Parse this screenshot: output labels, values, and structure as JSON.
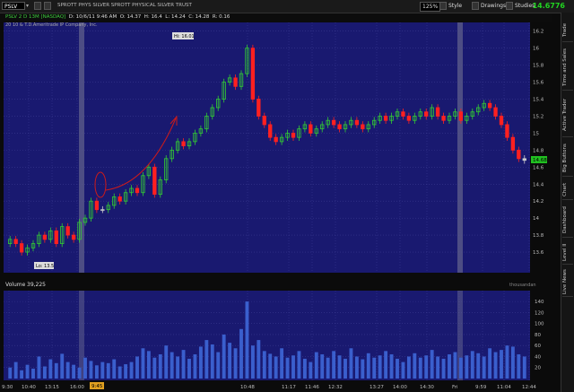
{
  "toolbar": {
    "symbol": "PSLV",
    "description": "SPROTT PHYS SILVER SPROTT PHYSICAL SILVER TRUST",
    "zoom_label": "125%",
    "style_label": "Style",
    "drawings_label": "Drawings",
    "studies_label": "Studies",
    "last_price": "14.6776"
  },
  "info": {
    "symbol_period": "PSLV 2 D 13M [NASDAQ]",
    "date_label": "D: 10/6/11 9:46 AM",
    "open_label": "O: 14.37",
    "high_label": "H: 16.4",
    "low_label": "L: 14.24",
    "close_label": "C: 14.28",
    "range_label": "R: 0.16",
    "copyright": "20 10 & T.D.Ameritrade IP Company, Inc."
  },
  "sidebar": {
    "tabs": [
      "Trade",
      "Time and Sales",
      "Active Trader",
      "Big Buttons",
      "Chart",
      "Dashboard",
      "Level II",
      "Live News"
    ]
  },
  "price_chart": {
    "y_ticks": [
      "16.2",
      "16",
      "15.8",
      "15.6",
      "15.4",
      "15.2",
      "15",
      "14.8",
      "14.6",
      "14.4",
      "14.2",
      "14",
      "13.8",
      "13.6"
    ],
    "hi_label": "Hi: 16.01",
    "lo_label": "Lo: 13.5",
    "current_price_label": "14.68"
  },
  "volume_chart": {
    "title": "Volume",
    "value": "39,225",
    "units_label": "thousandan",
    "y_ticks": [
      "140",
      "120",
      "100",
      "80",
      "60",
      "40",
      "20"
    ]
  },
  "x_axis": {
    "ticks": [
      "9:30",
      "10:40",
      "13:15",
      "16:00",
      "10:48",
      "11:17",
      "11:46",
      "12:32",
      "13:27",
      "14:00",
      "14:30",
      "Fri",
      "9:59",
      "11:04",
      "12:44"
    ],
    "highlight_label": "9:45"
  },
  "chart_data": {
    "type": "bar",
    "title": "",
    "xlabel": "",
    "ylabel": "",
    "price_ylim": [
      13.4,
      16.25
    ],
    "volume_ylim": [
      0,
      150
    ],
    "candles_close": [
      13.75,
      13.7,
      13.6,
      13.65,
      13.7,
      13.8,
      13.75,
      13.85,
      13.7,
      13.9,
      13.8,
      13.75,
      13.95,
      14.0,
      14.2,
      14.1,
      14.1,
      14.15,
      14.25,
      14.2,
      14.3,
      14.35,
      14.3,
      14.5,
      14.6,
      14.28,
      14.45,
      14.7,
      14.8,
      14.9,
      14.85,
      14.9,
      15.0,
      15.05,
      15.2,
      15.3,
      15.4,
      15.6,
      15.65,
      15.55,
      15.7,
      16.0,
      15.4,
      15.2,
      15.1,
      14.95,
      14.9,
      14.95,
      15.0,
      14.95,
      15.05,
      15.1,
      15.0,
      15.05,
      15.1,
      15.15,
      15.1,
      15.05,
      15.1,
      15.15,
      15.1,
      15.05,
      15.1,
      15.15,
      15.2,
      15.15,
      15.2,
      15.25,
      15.2,
      15.15,
      15.2,
      15.25,
      15.2,
      15.3,
      15.2,
      15.15,
      15.2,
      15.25,
      15.15,
      15.2,
      15.25,
      15.3,
      15.35,
      15.3,
      15.2,
      15.1,
      14.95,
      14.8,
      14.7,
      14.68
    ],
    "volume": [
      20,
      30,
      15,
      25,
      18,
      40,
      22,
      35,
      28,
      45,
      30,
      25,
      20,
      38,
      32,
      24,
      30,
      28,
      35,
      22,
      26,
      30,
      40,
      55,
      50,
      38,
      44,
      60,
      48,
      40,
      52,
      36,
      44,
      58,
      70,
      62,
      48,
      80,
      65,
      55,
      90,
      140,
      60,
      70,
      50,
      45,
      40,
      55,
      38,
      42,
      50,
      36,
      30,
      48,
      44,
      38,
      50,
      42,
      36,
      55,
      40,
      35,
      46,
      38,
      42,
      50,
      44,
      36,
      30,
      40,
      46,
      38,
      42,
      52,
      40,
      36,
      44,
      48,
      38,
      42,
      50,
      46,
      40,
      55,
      48,
      52,
      60,
      58,
      44,
      40
    ]
  },
  "colors": {
    "chart_bg": "#191970",
    "up": "#33cc33",
    "down": "#ff2020",
    "doji": "#cccccc",
    "volume": "#3a5fcd",
    "annotation": "#cc1a1a"
  }
}
